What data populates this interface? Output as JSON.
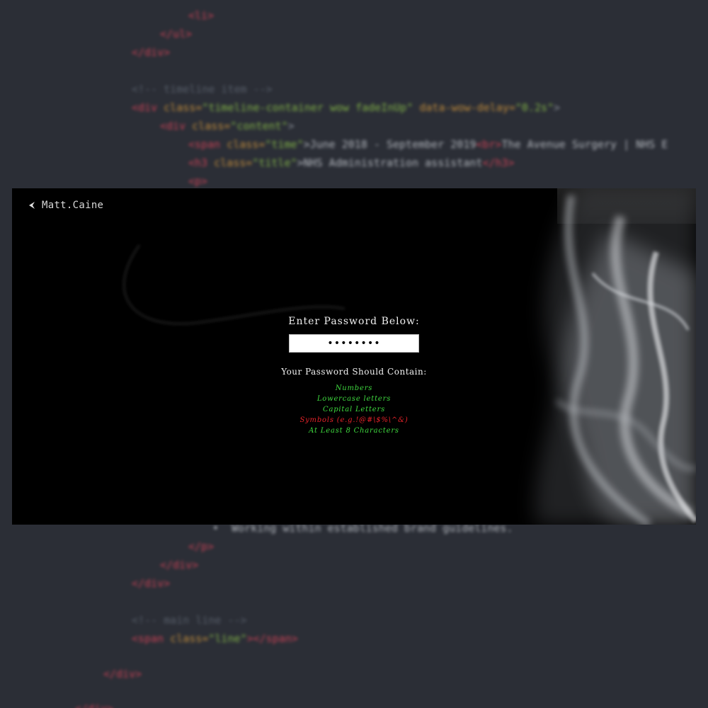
{
  "background_code": [
    [
      {
        "t": "<li>",
        "c": "c-tag"
      }
    ],
    [
      {
        "t": "</ul>",
        "c": "c-tag"
      }
    ],
    [
      {
        "t": "</div>",
        "c": "c-tag"
      }
    ],
    [
      {
        "t": "<!-- timeline item -->",
        "c": "c-comment"
      }
    ],
    [
      {
        "t": "<div ",
        "c": "c-tag"
      },
      {
        "t": "class=",
        "c": "c-attr"
      },
      {
        "t": "\"timeline-container wow fadeInUp\" ",
        "c": "c-str"
      },
      {
        "t": "data-wow-delay=",
        "c": "c-attr"
      },
      {
        "t": "\"0.2s\"",
        "c": "c-str"
      },
      {
        "t": ">",
        "c": "c-bracket"
      }
    ],
    [
      {
        "t": "<div ",
        "c": "c-tag"
      },
      {
        "t": "class=",
        "c": "c-attr"
      },
      {
        "t": "\"content\"",
        "c": "c-str"
      },
      {
        "t": ">",
        "c": "c-bracket"
      }
    ],
    [
      {
        "t": "<span ",
        "c": "c-tag"
      },
      {
        "t": "class=",
        "c": "c-attr"
      },
      {
        "t": "\"time\"",
        "c": "c-str"
      },
      {
        "t": ">June 2018 - September 2019",
        "c": "c-text"
      },
      {
        "t": "<br>",
        "c": "c-tag"
      },
      {
        "t": "The Avenue Surgery | NHS E",
        "c": "c-text"
      }
    ],
    [
      {
        "t": "<h3 ",
        "c": "c-tag"
      },
      {
        "t": "class=",
        "c": "c-attr"
      },
      {
        "t": "\"title\"",
        "c": "c-str"
      },
      {
        "t": ">NHS Administration assistant",
        "c": "c-text"
      },
      {
        "t": "</h3>",
        "c": "c-tag"
      }
    ],
    [
      {
        "t": "<p>",
        "c": "c-tag"
      }
    ],
    [
      {
        "t": "•  Working within established brand guidelines.",
        "c": "c-text"
      }
    ],
    [
      {
        "t": "</p>",
        "c": "c-tag"
      }
    ],
    [
      {
        "t": "</div>",
        "c": "c-tag"
      }
    ],
    [
      {
        "t": "</div>",
        "c": "c-tag"
      }
    ],
    [
      {
        "t": "<!-- main line -->",
        "c": "c-comment"
      }
    ],
    [
      {
        "t": "<span ",
        "c": "c-tag"
      },
      {
        "t": "class=",
        "c": "c-attr"
      },
      {
        "t": "\"line\"",
        "c": "c-str"
      },
      {
        "t": "></span>",
        "c": "c-tag"
      }
    ],
    [
      {
        "t": "</div>",
        "c": "c-tag"
      }
    ],
    [
      {
        "t": "</div>",
        "c": "c-tag"
      }
    ]
  ],
  "header": {
    "back_icon": "chevron-left-icon",
    "back_label": "Matt.Caine"
  },
  "form": {
    "prompt": "Enter Password Below:",
    "password_value": "passw0rd",
    "requirements_title": "Your Password Should Contain:",
    "requirements": [
      {
        "label": "Numbers",
        "met": true
      },
      {
        "label": "Lowercase letters",
        "met": true
      },
      {
        "label": "Capital Letters",
        "met": true
      },
      {
        "label": "Symbols (e.g.!@#\\$%\\^&)",
        "met": false
      },
      {
        "label": "At Least 8 Characters",
        "met": true
      }
    ]
  },
  "colors": {
    "met": "#3fd83f",
    "unmet": "#e8232a",
    "modal_bg": "#000000",
    "editor_bg": "#2b2e36"
  }
}
